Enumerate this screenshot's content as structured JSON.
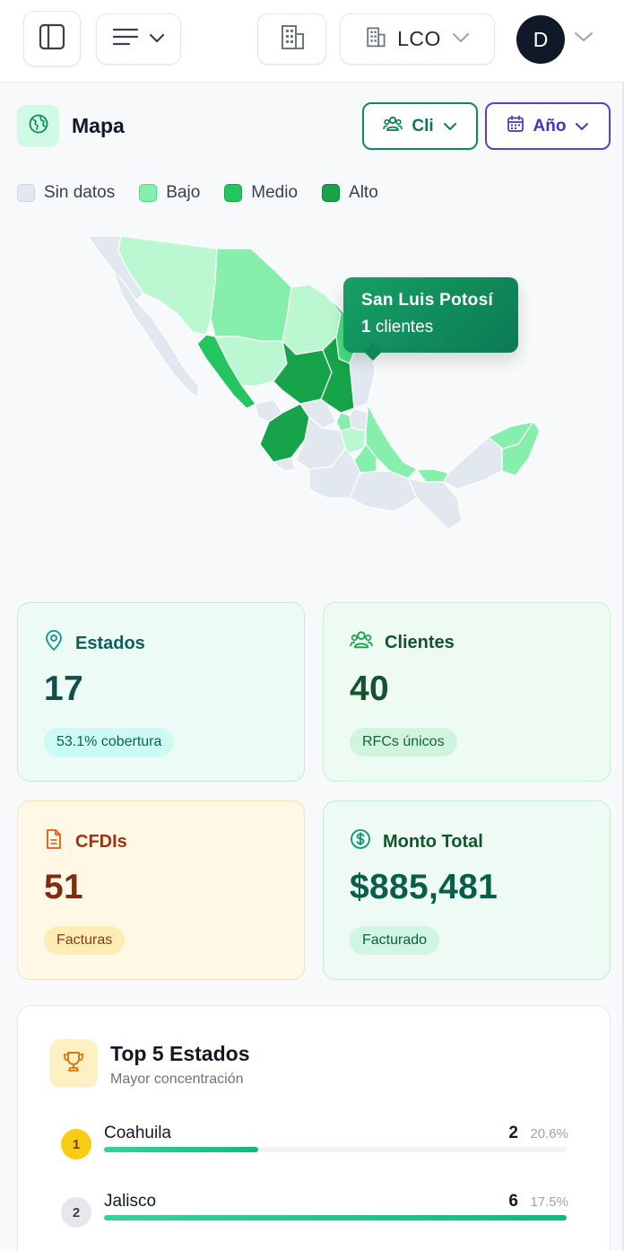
{
  "header": {
    "company": "LCO",
    "avatar_initial": "D"
  },
  "map_section": {
    "title": "Mapa",
    "filter_clients_label": "Cli",
    "filter_period_label": "Año",
    "legend": [
      {
        "label": "Sin datos",
        "color": "#e2e8f0"
      },
      {
        "label": "Bajo",
        "color": "#86efac"
      },
      {
        "label": "Medio",
        "color": "#22c55e"
      },
      {
        "label": "Alto",
        "color": "#16a34a"
      }
    ],
    "tooltip": {
      "state": "San Luis Potosí",
      "count": "1",
      "unit": " clientes"
    }
  },
  "stats": {
    "estados": {
      "title": "Estados",
      "value": "17",
      "pill": "53.1% cobertura"
    },
    "clientes": {
      "title": "Clientes",
      "value": "40",
      "pill": "RFCs únicos"
    },
    "cfdis": {
      "title": "CFDIs",
      "value": "51",
      "pill": "Facturas"
    },
    "monto": {
      "title": "Monto Total",
      "value": "$885,481",
      "pill": "Facturado"
    }
  },
  "top5": {
    "title": "Top 5 Estados",
    "subtitle": "Mayor concentración",
    "rows": [
      {
        "rank": "1",
        "name": "Coahuila",
        "count": "2",
        "pct": "20.6%",
        "fill": 0.333
      },
      {
        "rank": "2",
        "name": "Jalisco",
        "count": "6",
        "pct": "17.5%",
        "fill": 1.0
      }
    ]
  },
  "colors": {
    "accent_green": "#0f8a5f",
    "accent_purple": "#5b3fd0",
    "gold": "#facc15"
  }
}
